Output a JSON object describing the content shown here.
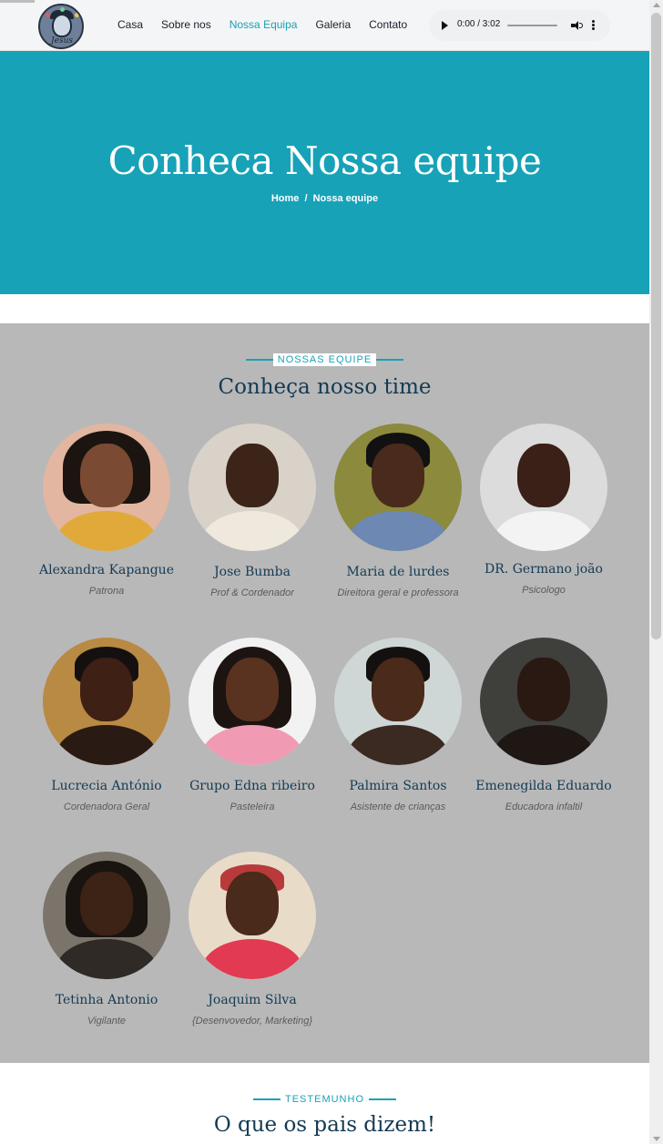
{
  "header": {
    "logo_text": "Jesus",
    "nav": [
      {
        "label": "Casa",
        "active": false
      },
      {
        "label": "Sobre nos",
        "active": false
      },
      {
        "label": "Nossa Equipa",
        "active": true
      },
      {
        "label": "Galeria",
        "active": false
      },
      {
        "label": "Contato",
        "active": false
      }
    ],
    "audio": {
      "time": "0:00 / 3:02",
      "play_icon": "play-icon",
      "volume_icon": "volume-icon",
      "more_icon": "more-vertical-icon"
    }
  },
  "hero": {
    "title": "Conheca Nossa equipe",
    "breadcrumb": {
      "home": "Home",
      "separator": "/",
      "current": "Nossa equipe"
    }
  },
  "team": {
    "eyebrow": "NOSSAS EQUIPE",
    "title": "Conheça nosso time",
    "members": [
      {
        "name": "Alexandra Kapangue",
        "role": "Patrona"
      },
      {
        "name": "Jose Bumba",
        "role": "Prof & Cordenador"
      },
      {
        "name": "Maria de lurdes",
        "role": "Direitora geral e professora"
      },
      {
        "name": "DR. Germano joão",
        "role": "Psicologo"
      },
      {
        "name": "Lucrecia António",
        "role": "Cordenadora Geral"
      },
      {
        "name": "Grupo Edna ribeiro",
        "role": "Pasteleira"
      },
      {
        "name": "Palmira Santos",
        "role": "Asistente de crianças"
      },
      {
        "name": "Emenegilda Eduardo",
        "role": "Educadora infaltil"
      },
      {
        "name": "Tetinha Antonio",
        "role": "Vigilante"
      },
      {
        "name": "Joaquim Silva",
        "role": "{Desenvovedor, Marketing}"
      }
    ]
  },
  "testimonials": {
    "eyebrow": "TESTEMUNHO",
    "title": "O que os pais dizem!"
  },
  "colors": {
    "accent": "#17a2b8",
    "heading": "#143a53",
    "team_bg": "#b8b8b8"
  }
}
